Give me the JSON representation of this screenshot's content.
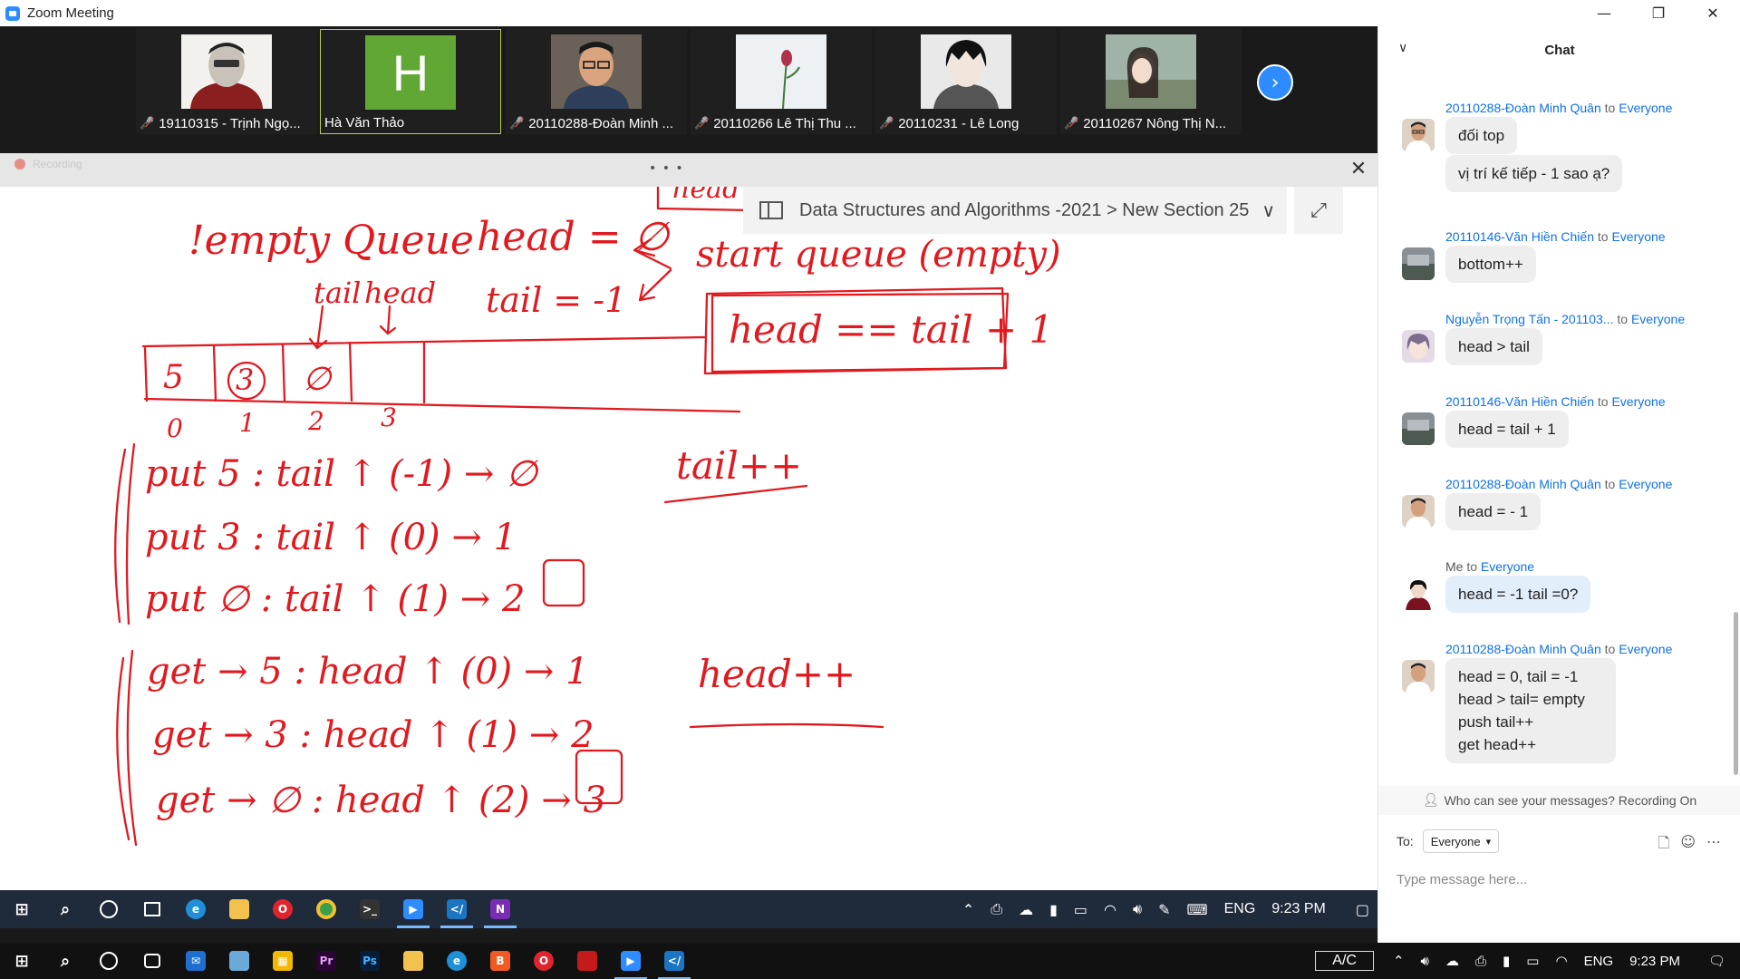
{
  "window": {
    "title": "Zoom Meeting",
    "controls": [
      "—",
      "❐",
      "✕"
    ]
  },
  "gallery": {
    "participants": [
      {
        "name": "19110315 - Trịnh Ngọ...",
        "muted": true
      },
      {
        "name": "Hà Văn Thảo",
        "muted": false,
        "initial": "H",
        "active": true
      },
      {
        "name": "20110288-Đoàn Minh ...",
        "muted": true
      },
      {
        "name": "20110266 Lê Thị Thu ...",
        "muted": true
      },
      {
        "name": "20110231 - Lê Long",
        "muted": true
      },
      {
        "name": "20110267 Nông Thị N...",
        "muted": true
      }
    ],
    "next_icon": "chevron-right-icon"
  },
  "share_bar": {
    "recording_label": "Recording",
    "drag_handle": "• • •",
    "close_icon": "✕"
  },
  "onenote": {
    "breadcrumb": "Data Structures and Algorithms -2021 > New Section 25",
    "breadcrumb_chevron": "∨",
    "expand_icon": "⤢"
  },
  "whiteboard": {
    "ink": {
      "empty_queue": "!empty Queue",
      "head_eq": "head = ∅",
      "tail_eq": "tail = -1",
      "start_queue": "start queue (empty)",
      "head_cmp": "head == tail + 1",
      "tail_label": "tail",
      "head_label": "head",
      "cells": [
        "5",
        "3",
        "∅",
        ""
      ],
      "indices": [
        "0",
        "1",
        "2",
        "3"
      ],
      "put_lines": [
        "put 5 : tail ↑ (-1) → ∅",
        "put 3 : tail ↑ (0) → 1",
        "put ∅ : tail ↑ (1) → 2"
      ],
      "get_lines": [
        "get → 5 : head ↑ (0) → 1",
        "get → 3 : head ↑ (1) → 2",
        "get → ∅ : head ↑ (2) → 3"
      ],
      "tail_pp": "tail++",
      "head_pp": "head++",
      "top_fragment": "head"
    }
  },
  "inner_taskbar": {
    "apps": [
      "windows",
      "search",
      "cortana",
      "task-view",
      "edge",
      "explorer",
      "opera",
      "chrome",
      "terminal",
      "zoom",
      "vscode",
      "onenote"
    ],
    "tray": {
      "chevron": "⌃",
      "lang": "ENG",
      "time": "9:23 PM"
    }
  },
  "chat": {
    "header_title": "Chat",
    "collapse_icon": "∨",
    "messages": [
      {
        "from": "20110288-Đoàn Minh Quân",
        "to_word": "to",
        "target": "Everyone",
        "lines": [
          "đối top"
        ],
        "avatar": "glasses-man"
      },
      {
        "from": "",
        "to_word": "",
        "target": "",
        "lines": [
          "vị trí kế tiếp - 1 sao ạ?"
        ],
        "avatar": ""
      },
      {
        "from": "20110146-Văn Hiền Chiến",
        "to_word": "to",
        "target": "Everyone",
        "lines": [
          "bottom++"
        ],
        "avatar": "landscape"
      },
      {
        "from": "Nguyễn Trọng Tấn - 201103...",
        "to_word": "to",
        "target": "Everyone",
        "lines": [
          "head > tail"
        ],
        "avatar": "anime"
      },
      {
        "from": "20110146-Văn Hiền Chiến",
        "to_word": "to",
        "target": "Everyone",
        "lines": [
          "head = tail + 1"
        ],
        "avatar": "landscape"
      },
      {
        "from": "20110288-Đoàn Minh Quân",
        "to_word": "to",
        "target": "Everyone",
        "lines": [
          "head = - 1"
        ],
        "avatar": "glasses-man"
      },
      {
        "from": "Me",
        "to_word": "to",
        "target": "Everyone",
        "lines": [
          "head = -1 tail =0?"
        ],
        "avatar": "me",
        "mine": true
      },
      {
        "from": "20110288-Đoàn Minh Quân",
        "to_word": "to",
        "target": "Everyone",
        "lines": [
          "head = 0, tail = -1",
          "head > tail= empty",
          "push tail++",
          "get head++"
        ],
        "avatar": "glasses-man"
      }
    ],
    "privacy_text": "Who can see your messages? Recording On",
    "to_label": "To:",
    "to_value": "Everyone",
    "input_placeholder": "Type message here..."
  },
  "taskbar": {
    "ac_label": "A/C",
    "lang": "ENG",
    "time": "9:23 PM"
  }
}
